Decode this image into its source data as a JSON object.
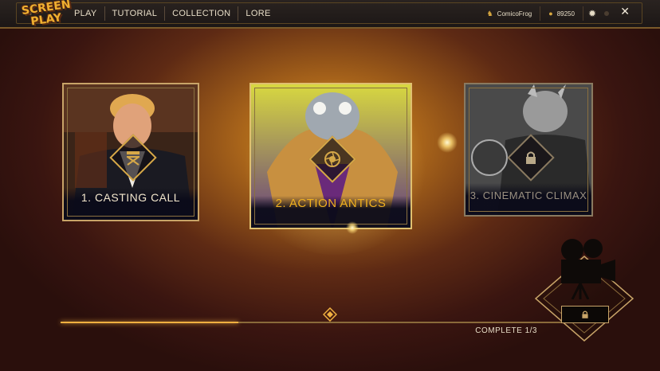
{
  "logo": {
    "text_line1": "SCREEN",
    "text_line2": "PLAY"
  },
  "nav": {
    "items": [
      "PLAY",
      "TUTORIAL",
      "COLLECTION",
      "LORE"
    ]
  },
  "user": {
    "name": "ComicoFrog",
    "currency": "89250"
  },
  "icons": {
    "back": "back-arrow-icon",
    "user": "user-icon",
    "coin": "coin-icon",
    "settings": "gear-icon",
    "close": "close-icon"
  },
  "chapters": [
    {
      "label": "1. CASTING CALL",
      "icon": "director-chair-icon",
      "state": "completed"
    },
    {
      "label": "2. ACTION ANTICS",
      "icon": "camera-aperture-icon",
      "state": "current"
    },
    {
      "label": "3. CINEMATIC CLIMAX",
      "icon": "lock-icon",
      "state": "locked"
    }
  ],
  "progress": {
    "label": "COMPLETE 1/3",
    "fraction": 0.33
  },
  "reward": {
    "icon": "film-camera-icon",
    "lock_icon": "lock-icon"
  },
  "colors": {
    "accent": "#f0b040",
    "frame": "#c8a468",
    "text": "#e6dcc6"
  }
}
